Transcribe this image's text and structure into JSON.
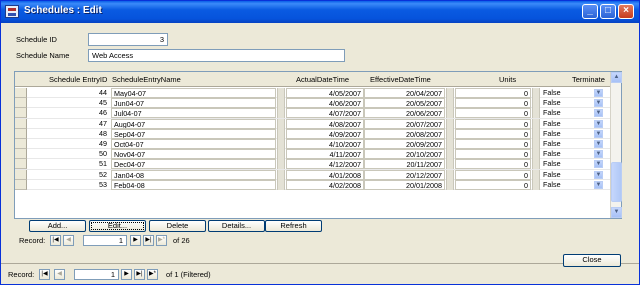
{
  "window": {
    "title": "Schedules : Edit"
  },
  "form": {
    "schedule_id_label": "Schedule ID",
    "schedule_id_value": "3",
    "schedule_name_label": "Schedule Name",
    "schedule_name_value": "Web Access"
  },
  "grid": {
    "columns": [
      "Schedule EntryID",
      "ScheduleEntryName",
      "ActualDateTime",
      "EffectiveDateTime",
      "Units",
      "Terminate"
    ],
    "rows": [
      {
        "id": "44",
        "name": "May04-07",
        "actual": "4/05/2007",
        "effective": "20/04/2007",
        "units": "0",
        "terminate": "False"
      },
      {
        "id": "45",
        "name": "Jun04-07",
        "actual": "4/06/2007",
        "effective": "20/05/2007",
        "units": "0",
        "terminate": "False"
      },
      {
        "id": "46",
        "name": "Jul04-07",
        "actual": "4/07/2007",
        "effective": "20/06/2007",
        "units": "0",
        "terminate": "False"
      },
      {
        "id": "47",
        "name": "Aug04-07",
        "actual": "4/08/2007",
        "effective": "20/07/2007",
        "units": "0",
        "terminate": "False"
      },
      {
        "id": "48",
        "name": "Sep04-07",
        "actual": "4/09/2007",
        "effective": "20/08/2007",
        "units": "0",
        "terminate": "False"
      },
      {
        "id": "49",
        "name": "Oct04-07",
        "actual": "4/10/2007",
        "effective": "20/09/2007",
        "units": "0",
        "terminate": "False"
      },
      {
        "id": "50",
        "name": "Nov04-07",
        "actual": "4/11/2007",
        "effective": "20/10/2007",
        "units": "0",
        "terminate": "False"
      },
      {
        "id": "51",
        "name": "Dec04-07",
        "actual": "4/12/2007",
        "effective": "20/11/2007",
        "units": "0",
        "terminate": "False"
      },
      {
        "id": "52",
        "name": "Jan04-08",
        "actual": "4/01/2008",
        "effective": "20/12/2007",
        "units": "0",
        "terminate": "False"
      },
      {
        "id": "53",
        "name": "Feb04-08",
        "actual": "4/02/2008",
        "effective": "20/01/2008",
        "units": "0",
        "terminate": "False"
      }
    ]
  },
  "buttons": {
    "add": "Add...",
    "edit": "Edit...",
    "delete": "Delete",
    "details": "Details...",
    "refresh": "Refresh",
    "close": "Close"
  },
  "subform_nav": {
    "label": "Record:",
    "current": "1",
    "of_text": "of  26"
  },
  "main_nav": {
    "label": "Record:",
    "current": "1",
    "of_text": "of  1 (Filtered)"
  },
  "icons": {
    "first": "first-record-icon",
    "prev": "previous-record-icon",
    "next": "next-record-icon",
    "last": "last-record-icon",
    "new": "new-record-icon",
    "dropdown": "chevron-down-icon"
  },
  "colors": {
    "titlebar": "#0a5ee8",
    "window_bg": "#ece9d8",
    "border": "#7f9db9"
  }
}
